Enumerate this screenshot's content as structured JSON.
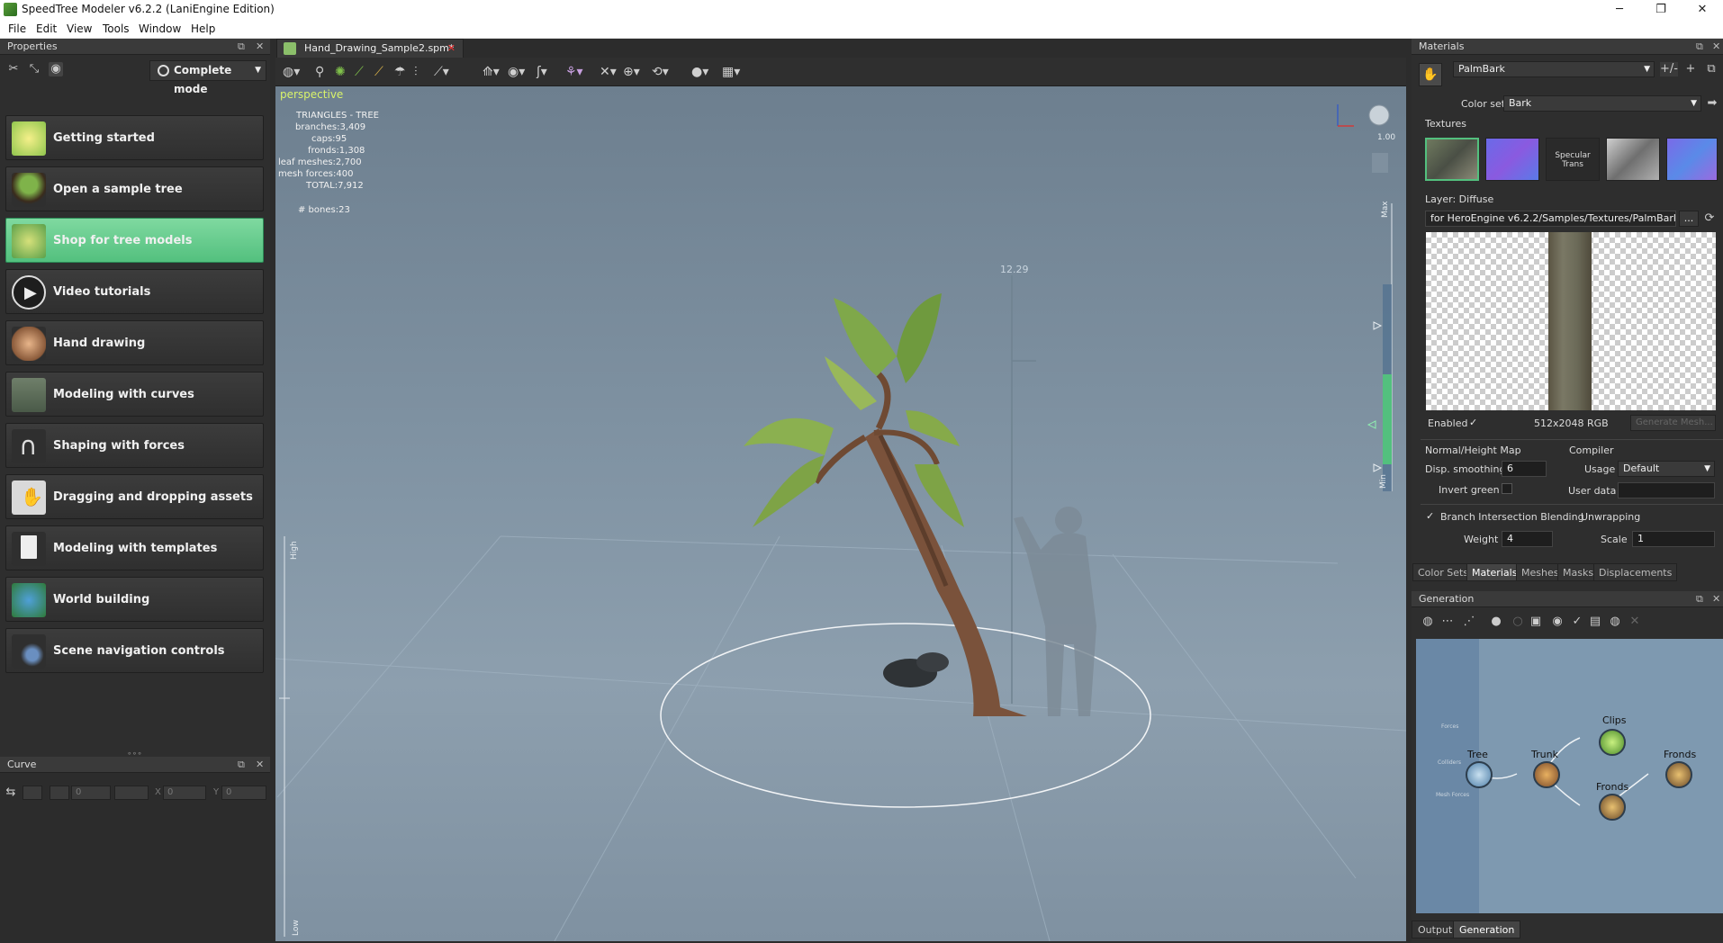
{
  "window": {
    "title": "SpeedTree Modeler v6.2.2 (LaniEngine Edition)",
    "minimize": "─",
    "maximize": "❐",
    "close": "✕"
  },
  "menu": [
    "File",
    "Edit",
    "View",
    "Tools",
    "Window",
    "Help"
  ],
  "properties": {
    "title": "Properties",
    "mode": "Complete mode",
    "tutorials": [
      {
        "label": "Getting started",
        "icon": "lightbulb-icon"
      },
      {
        "label": "Open a sample tree",
        "icon": "tree-icon"
      },
      {
        "label": "Shop for tree models",
        "icon": "shop-icon"
      },
      {
        "label": "Video tutorials",
        "icon": "play-icon"
      },
      {
        "label": "Hand drawing",
        "icon": "hand-icon"
      },
      {
        "label": "Modeling with curves",
        "icon": "curves-icon"
      },
      {
        "label": "Shaping with forces",
        "icon": "magnet-icon"
      },
      {
        "label": "Dragging and dropping assets",
        "icon": "drag-hand-icon"
      },
      {
        "label": "Modeling with templates",
        "icon": "template-icon"
      },
      {
        "label": "World building",
        "icon": "world-icon"
      },
      {
        "label": "Scene navigation controls",
        "icon": "navigation-icon"
      }
    ]
  },
  "curve": {
    "title": "Curve",
    "x_label": "X",
    "y_label": "Y",
    "value_a": "0",
    "value_x": "0",
    "value_y": "0"
  },
  "viewport": {
    "tab": "Hand_Drawing_Sample2.spm*",
    "view_label": "perspective",
    "stats": {
      "heading": "TRIANGLES - TREE",
      "lines": [
        "branches:3,409",
        "caps:95",
        "fronds:1,308",
        "leaf meshes:2,700",
        "mesh forces:400",
        "TOTAL:7,912"
      ],
      "bones": "# bones:23"
    },
    "height_marker": "12.29",
    "slider_max": "Max",
    "slider_min": "Min",
    "slider_high": "High",
    "slider_low": "Low",
    "zoom_value": "1.00"
  },
  "materials": {
    "title": "Materials",
    "material_name": "PalmBark",
    "color_set_label": "Color set",
    "color_set": "Bark",
    "textures_label": "Textures",
    "specular_trans": "Specular Trans",
    "layer_label": "Layer: Diffuse",
    "path": "for HeroEngine v6.2.2/Samples/Textures/PalmBark.tga",
    "browse": "...",
    "enabled_label": "Enabled",
    "resolution": "512x2048 RGB",
    "generate_mesh": "Generate Mesh...",
    "normal_map_label": "Normal/Height Map",
    "disp_smoothing_label": "Disp. smoothing",
    "disp_smoothing": "6",
    "invert_green_label": "Invert green",
    "compiler_label": "Compiler",
    "usage_label": "Usage",
    "usage": "Default",
    "user_data_label": "User data",
    "branch_blend_label": "Branch Intersection Blending",
    "weight_label": "Weight",
    "weight": "4",
    "unwrapping_label": "Unwrapping",
    "scale_label": "Scale",
    "scale": "1",
    "tabs": [
      "Color Sets",
      "Materials",
      "Meshes",
      "Masks",
      "Displacements"
    ]
  },
  "generation": {
    "title": "Generation",
    "side_labels": [
      "Forces",
      "Colliders",
      "Mesh Forces"
    ],
    "nodes": [
      "Tree",
      "Trunk",
      "Clips",
      "Fronds",
      "Fronds"
    ],
    "bottom_tabs": [
      "Output",
      "Generation"
    ]
  }
}
